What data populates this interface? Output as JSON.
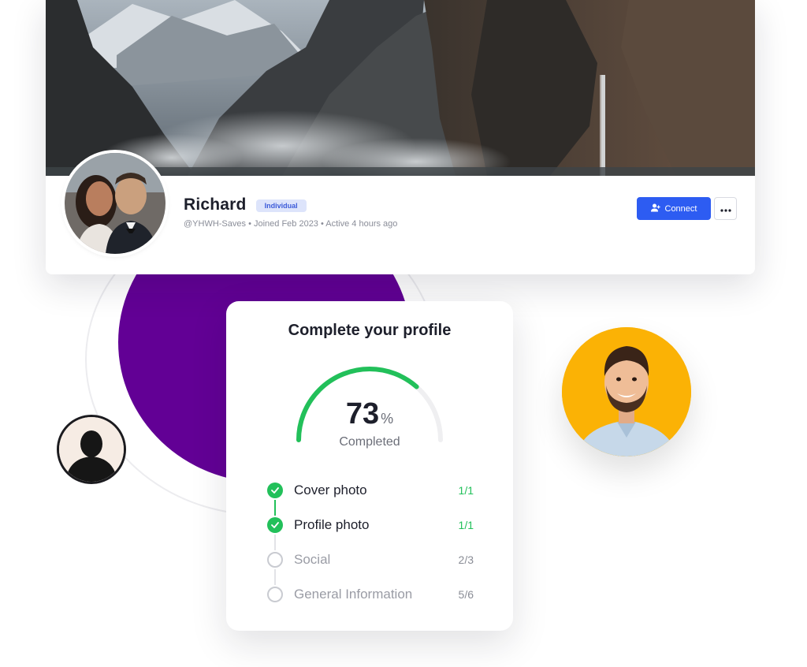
{
  "profile": {
    "name": "Richard",
    "badge": "Individual",
    "meta": "@YHWH-Saves • Joined Feb 2023 • Active 4 hours ago",
    "connect_label": "Connect",
    "more_icon": "more-horizontal-icon",
    "connect_icon": "add-user-icon"
  },
  "completion": {
    "title": "Complete your profile",
    "percent": "73",
    "percent_sign": "%",
    "percent_value": 0.73,
    "label": "Completed",
    "steps": [
      {
        "label": "Cover photo",
        "count": "1/1",
        "done": true
      },
      {
        "label": "Profile photo",
        "count": "1/1",
        "done": true
      },
      {
        "label": "Social",
        "count": "2/3",
        "done": false
      },
      {
        "label": "General Information",
        "count": "5/6",
        "done": false
      }
    ]
  },
  "colors": {
    "accent": "#2d5cf2",
    "success": "#22c05a",
    "purple": "#620095",
    "avatar_bg": "#fbb205",
    "badge_bg": "#dde4fb",
    "badge_text": "#3c5bd9"
  }
}
